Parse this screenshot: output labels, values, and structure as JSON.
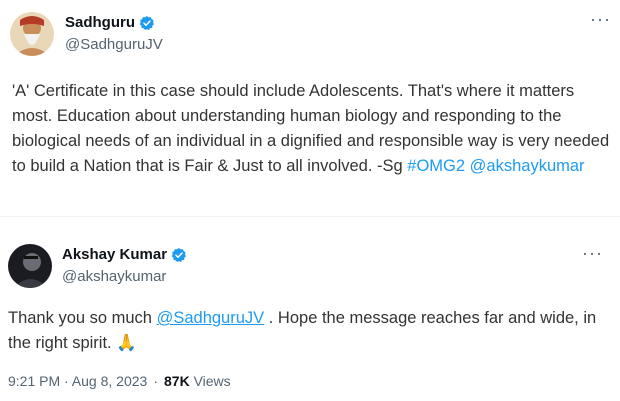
{
  "tweet1": {
    "author_name": "Sadhguru",
    "handle": "@SadhguruJV",
    "text_plain": "'A' Certificate in this case should include Adolescents. That's where it matters most. Education about understanding human biology and responding to the biological needs of an individual in a dignified and responsible way is very needed to build a Nation that is Fair & Just to all involved. -Sg",
    "hashtag": "#OMG2",
    "mention": "@akshaykumar",
    "more_icon": "···"
  },
  "tweet2": {
    "author_name": "Akshay Kumar",
    "handle": "@akshaykumar",
    "text_before": "Thank you so much",
    "mention": "@SadhguruJV",
    "text_after": " . Hope the message reaches far and wide, in the right spirit.",
    "emoji": "🙏",
    "more_icon": "···",
    "timestamp": "9:21 PM · Aug 8, 2023",
    "separator": "·",
    "views_count": "87K",
    "views_label": "Views"
  },
  "colors": {
    "accent": "#1d9bf0",
    "text": "#0f1419",
    "muted": "#536471"
  }
}
